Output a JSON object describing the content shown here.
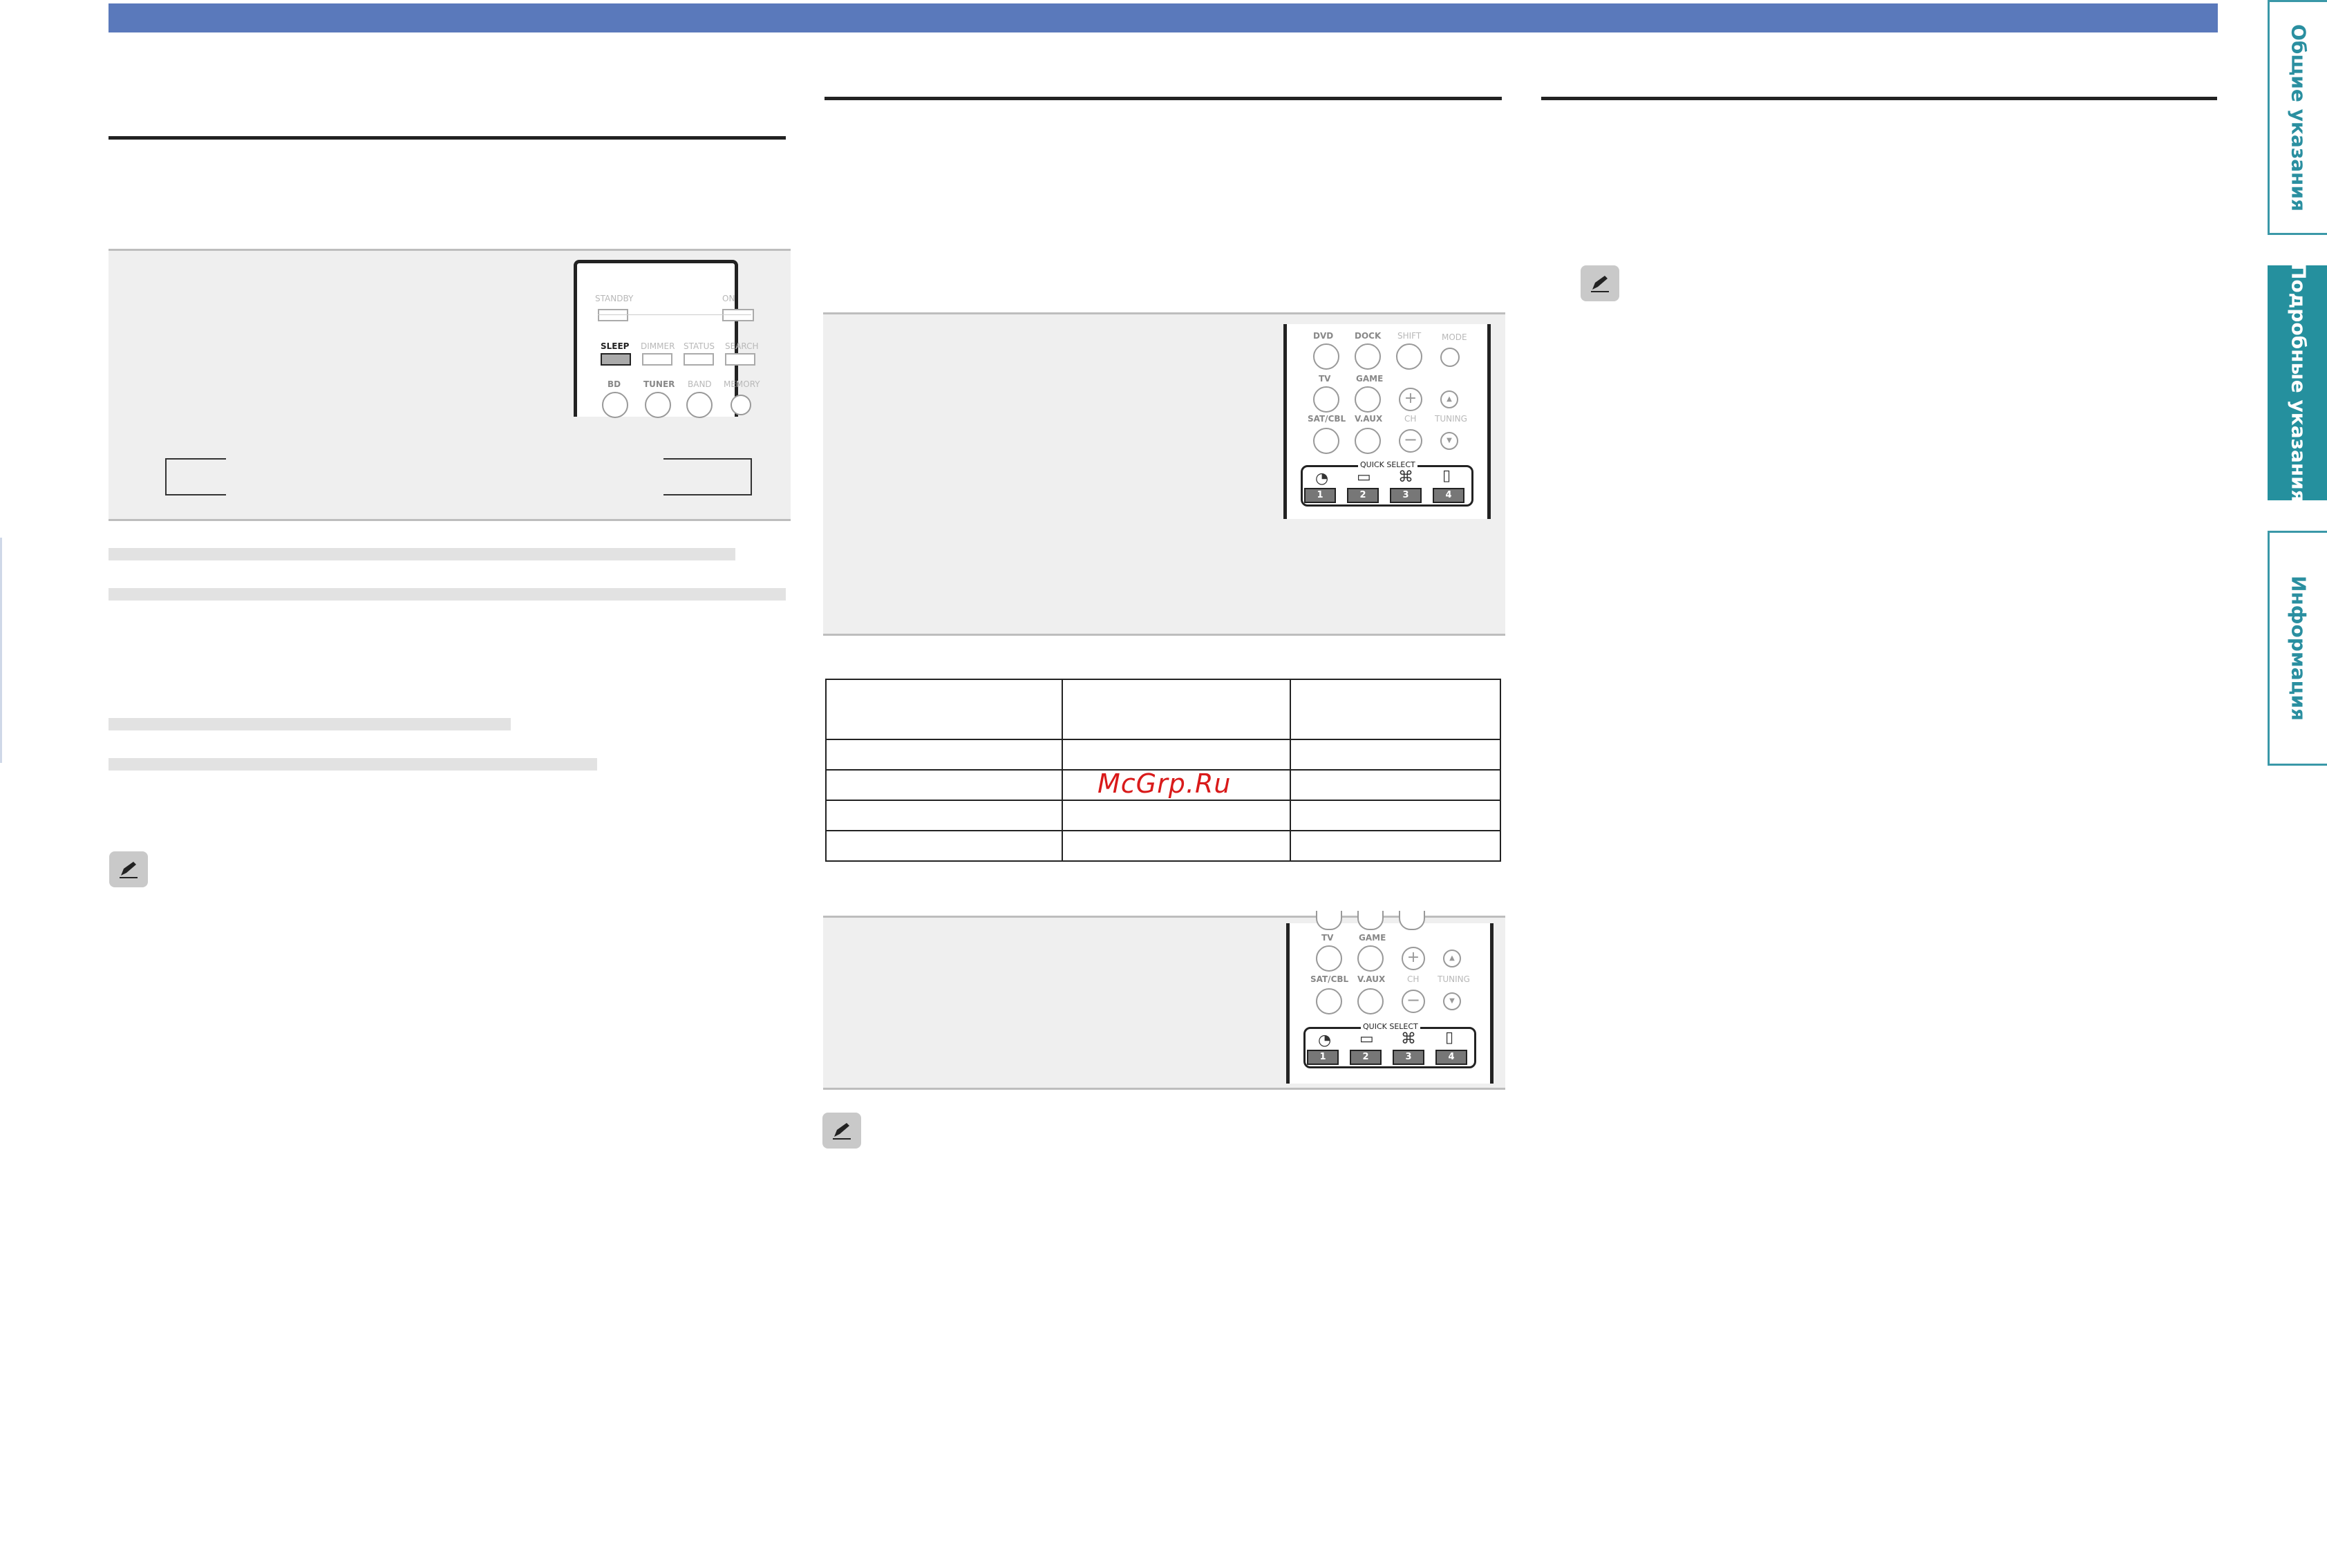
{
  "header": {
    "bar_color": "#5a79bb"
  },
  "side_tabs": [
    {
      "label": "Общие указания",
      "active": false
    },
    {
      "label": "Подробные указания",
      "active": true
    },
    {
      "label": "Информация",
      "active": false
    }
  ],
  "remote_top": {
    "standby": "STANDBY",
    "on": "ON",
    "sleep": "SLEEP",
    "dimmer": "DIMMER",
    "status": "STATUS",
    "search": "SEARCH",
    "bd": "BD",
    "tuner": "TUNER",
    "band": "BAND",
    "memory": "MEMORY"
  },
  "remote_mid": {
    "dvd": "DVD",
    "dock": "DOCK",
    "shift": "SHIFT",
    "mode": "MODE",
    "tv": "TV",
    "game": "GAME",
    "sat_cbl": "SAT/CBL",
    "vaux": "V.AUX",
    "ch": "CH",
    "tuning": "TUNING",
    "quick_select": "QUICK SELECT",
    "keys": [
      "1",
      "2",
      "3",
      "4"
    ]
  },
  "remote_bottom": {
    "tv": "TV",
    "game": "GAME",
    "sat_cbl": "SAT/CBL",
    "vaux": "V.AUX",
    "ch": "CH",
    "tuning": "TUNING",
    "quick_select": "QUICK SELECT",
    "keys": [
      "1",
      "2",
      "3",
      "4"
    ]
  },
  "watermark": "McGrp.Ru",
  "icons": {
    "note": "pencil-icon"
  }
}
